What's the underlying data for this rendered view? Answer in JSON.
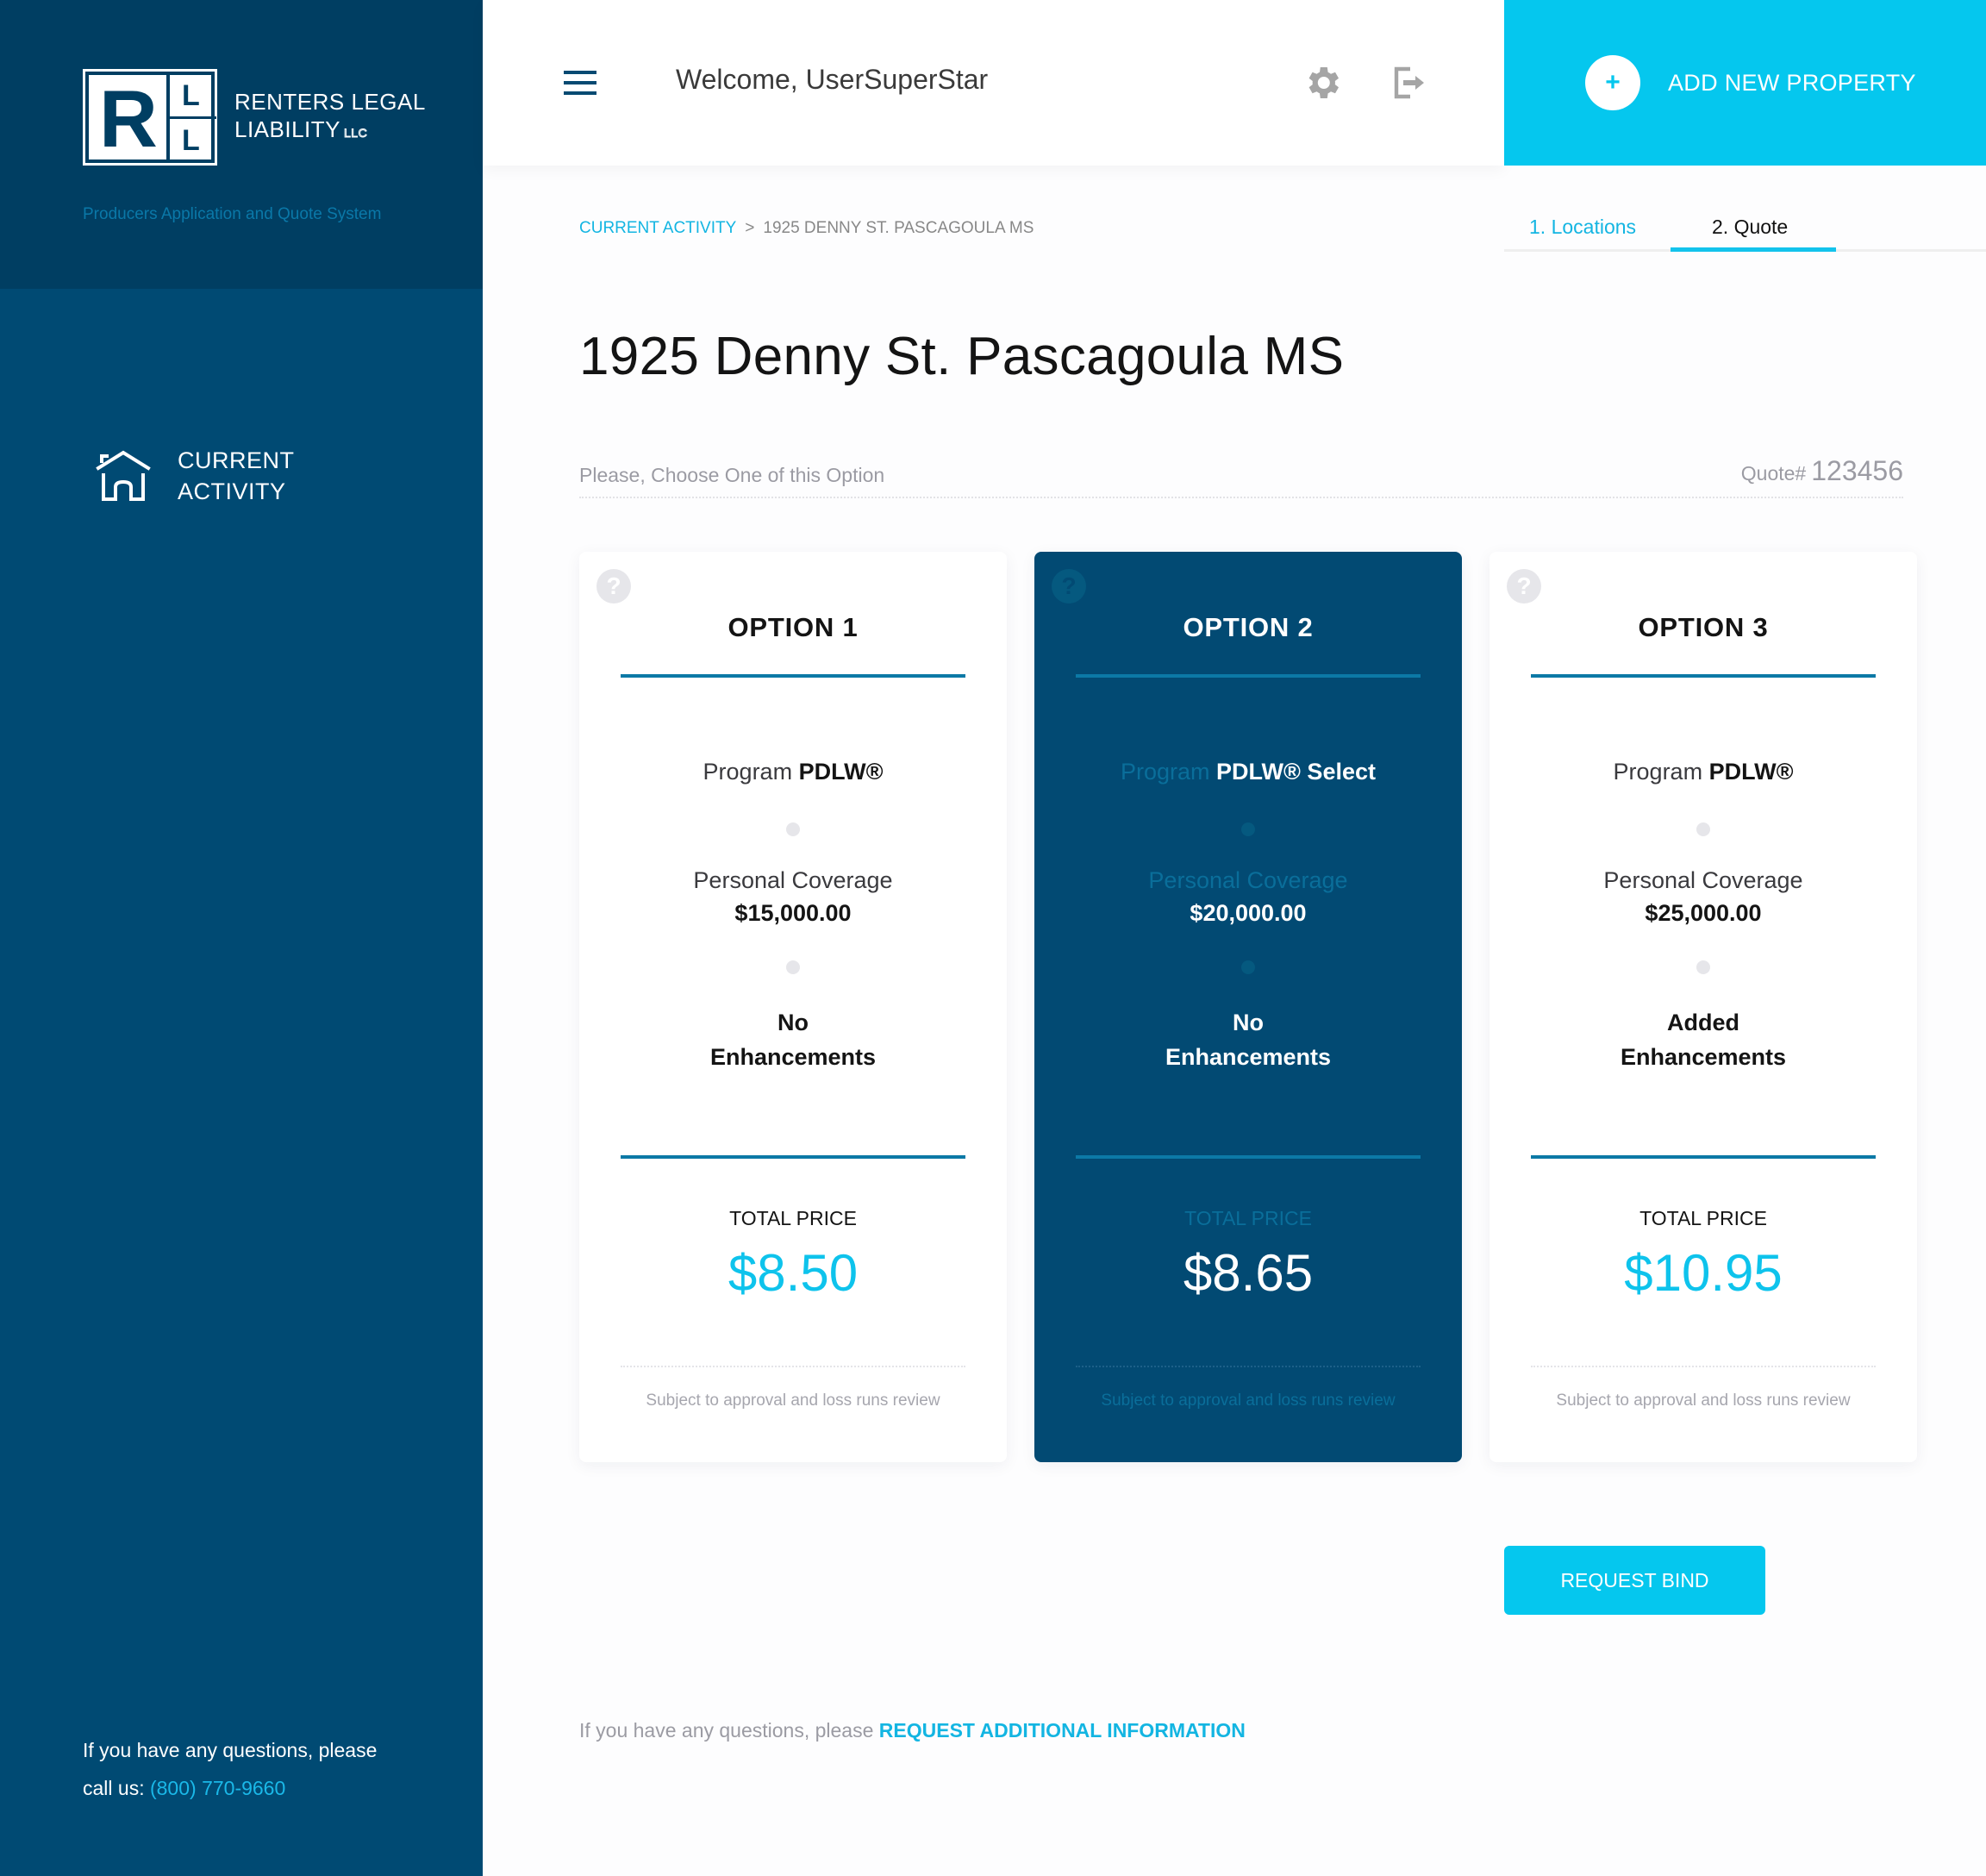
{
  "brand": {
    "name_line1": "RENTERS LEGAL",
    "name_line2": "LIABILITY",
    "llc": "LLC",
    "logo_letters": {
      "big": "R",
      "top": "L",
      "bottom": "L"
    },
    "tagline": "Producers Application and Quote System"
  },
  "sidebar": {
    "items": [
      {
        "label_line1": "CURRENT",
        "label_line2": "ACTIVITY",
        "icon": "home-icon"
      }
    ],
    "footer": {
      "line1": "If you have any questions, please",
      "line2_prefix": "call us:",
      "phone": "(800) 770-9660"
    }
  },
  "header": {
    "welcome": "Welcome, UserSuperStar",
    "icons": [
      "menu-icon",
      "gear-icon",
      "logout-icon"
    ],
    "add_button": {
      "icon": "+",
      "label": "ADD NEW PROPERTY"
    }
  },
  "breadcrumb": {
    "root": "CURRENT ACTIVITY",
    "separator": ">",
    "current": "1925 DENNY ST. PASCAGOULA MS"
  },
  "steps": {
    "tabs": [
      {
        "label": "1. Locations",
        "active": false
      },
      {
        "label": "2. Quote",
        "active": true
      }
    ]
  },
  "page": {
    "title": "1925 Denny St. Pascagoula MS",
    "instruction": "Please, Choose One of this Option",
    "quote_label": "Quote#",
    "quote_number": "123456"
  },
  "options": [
    {
      "title": "OPTION 1",
      "help_icon": "?",
      "program_label": "Program",
      "program_name": "PDLW®",
      "coverage_label": "Personal Coverage",
      "coverage_value": "$15,000.00",
      "enhancements_line1": "No",
      "enhancements_line2": "Enhancements",
      "price_label": "TOTAL PRICE",
      "price": "$8.50",
      "fine_print": "Subject to approval and loss runs review",
      "selected": false
    },
    {
      "title": "OPTION 2",
      "help_icon": "?",
      "program_label": "Program",
      "program_name": "PDLW® Select",
      "coverage_label": "Personal Coverage",
      "coverage_value": "$20,000.00",
      "enhancements_line1": "No",
      "enhancements_line2": "Enhancements",
      "price_label": "TOTAL PRICE",
      "price": "$8.65",
      "fine_print": "Subject to approval and loss runs review",
      "selected": true
    },
    {
      "title": "OPTION 3",
      "help_icon": "?",
      "program_label": "Program",
      "program_name": "PDLW®",
      "coverage_label": "Personal Coverage",
      "coverage_value": "$25,000.00",
      "enhancements_line1": "Added",
      "enhancements_line2": "Enhancements",
      "price_label": "TOTAL PRICE",
      "price": "$10.95",
      "fine_print": "Subject to approval and loss runs review",
      "selected": false
    }
  ],
  "actions": {
    "request_bind": "REQUEST BIND"
  },
  "footer": {
    "prefix": "If you have any questions, please",
    "link": "REQUEST ADDITIONAL INFORMATION"
  },
  "colors": {
    "sidebar": "#004a73",
    "sidebar_top": "#003e62",
    "accent": "#05c7ee",
    "selected_card": "#024a73",
    "rule": "#0c79a6"
  }
}
